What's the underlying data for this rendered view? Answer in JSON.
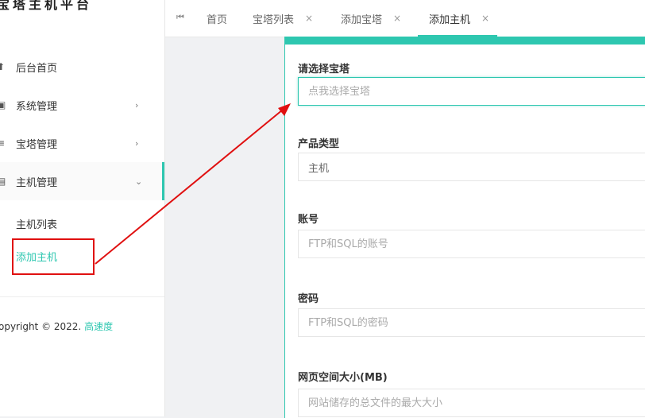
{
  "sidebar": {
    "brand": "宝塔主机平台",
    "items": [
      {
        "label": "后台首页",
        "icon": "home-icon"
      },
      {
        "label": "系统管理",
        "icon": "grid-icon",
        "chevron": "›"
      },
      {
        "label": "宝塔管理",
        "icon": "list-icon",
        "chevron": "›"
      },
      {
        "label": "主机管理",
        "icon": "server-icon",
        "chevron": "⌄"
      }
    ],
    "sub_items": [
      {
        "label": "主机列表"
      },
      {
        "label": "添加主机"
      }
    ],
    "copyright_prefix": "opyright © 2022. ",
    "copyright_link": "高速度"
  },
  "tabs": {
    "first_icon": "⏮",
    "items": [
      {
        "label": "首页"
      },
      {
        "label": "宝塔列表",
        "close": "×"
      },
      {
        "label": "添加宝塔",
        "close": "×"
      },
      {
        "label": "添加主机",
        "close": "×"
      }
    ]
  },
  "form": {
    "select_bt": {
      "label": "请选择宝塔",
      "placeholder": "点我选择宝塔"
    },
    "product_type": {
      "label": "产品类型",
      "value": "主机"
    },
    "account": {
      "label": "账号",
      "placeholder": "FTP和SQL的账号"
    },
    "password": {
      "label": "密码",
      "placeholder": "FTP和SQL的密码"
    },
    "web_space": {
      "label": "网页空间大小(MB)",
      "placeholder": "网站储存的总文件的最大大小"
    }
  },
  "colors": {
    "accent": "#2ec7b0",
    "annotation": "#e01010"
  }
}
